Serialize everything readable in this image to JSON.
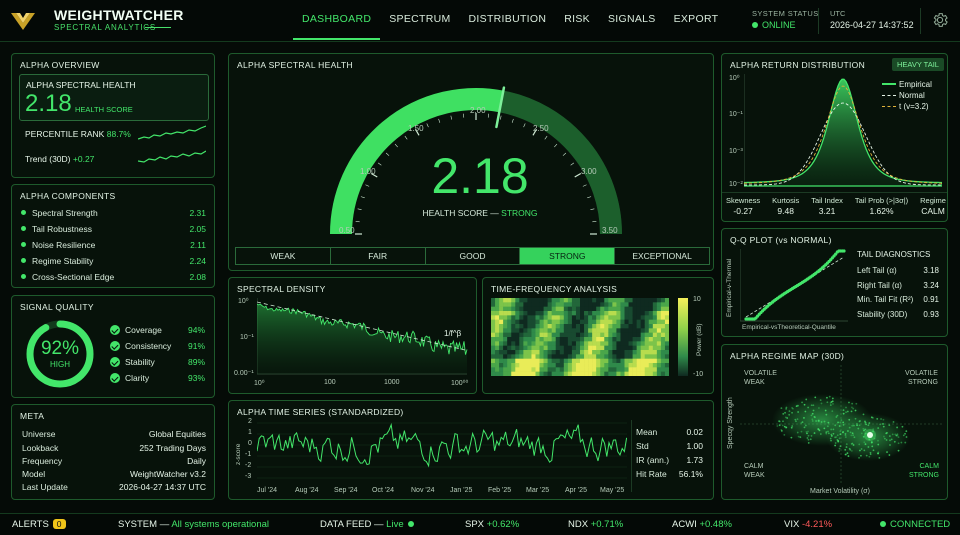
{
  "header": {
    "brand": "WEIGHTWATCHER",
    "subtitle": "SPECTRAL ANALYTICS",
    "nav": [
      "DASHBOARD",
      "SPECTRUM",
      "DISTRIBUTION",
      "RISK",
      "SIGNALS",
      "EXPORT"
    ],
    "active_nav": "DASHBOARD",
    "system_status_label": "SYSTEM STATUS",
    "system_status": "ONLINE",
    "utc_label": "UTC",
    "utc_time": "2026-04-27 14:37:52"
  },
  "alpha_overview": {
    "title": "ALPHA OVERVIEW",
    "health_label": "ALPHA SPECTRAL HEALTH",
    "health_value": "2.18",
    "health_unit": "HEALTH SCORE",
    "percentile_label": "PERCENTILE RANK",
    "percentile_value": "88.7%",
    "trend_label": "Trend (30D)",
    "trend_value": "+0.27"
  },
  "components": {
    "title": "ALPHA COMPONENTS",
    "items": [
      {
        "label": "Spectral Strength",
        "value": "2.31"
      },
      {
        "label": "Tail Robustness",
        "value": "2.05"
      },
      {
        "label": "Noise Resilience",
        "value": "2.11"
      },
      {
        "label": "Regime Stability",
        "value": "2.24"
      },
      {
        "label": "Cross-Sectional Edge",
        "value": "2.08"
      }
    ]
  },
  "signal_quality": {
    "title": "SIGNAL QUALITY",
    "score": "92%",
    "score_fraction": 0.92,
    "score_label": "HIGH",
    "items": [
      {
        "label": "Coverage",
        "value": "94%"
      },
      {
        "label": "Consistency",
        "value": "91%"
      },
      {
        "label": "Stability",
        "value": "89%"
      },
      {
        "label": "Clarity",
        "value": "93%"
      }
    ]
  },
  "meta": {
    "title": "META",
    "items": [
      {
        "label": "Universe",
        "value": "Global Equities"
      },
      {
        "label": "Lookback",
        "value": "252 Trading Days"
      },
      {
        "label": "Frequency",
        "value": "Daily"
      },
      {
        "label": "Model",
        "value": "WeightWatcher v3.2"
      },
      {
        "label": "Last Update",
        "value": "2026-04-27 14:37 UTC"
      }
    ]
  },
  "gauge": {
    "title": "ALPHA SPECTRAL HEALTH",
    "value": "2.18",
    "value_num": 2.18,
    "min": 0.5,
    "max": 3.5,
    "ticks": [
      "0.50",
      "1.00",
      "1.50",
      "2.00",
      "2.50",
      "3.00",
      "3.50"
    ],
    "caption_label": "HEALTH SCORE —",
    "caption_status": "STRONG",
    "bands": [
      "WEAK",
      "FAIR",
      "GOOD",
      "STRONG",
      "EXCEPTIONAL"
    ],
    "active_band": "STRONG"
  },
  "spectral_density": {
    "title": "SPECTRAL DENSITY",
    "y_ticks": [
      "10⁰",
      "10⁻¹",
      "0.00⁻¹"
    ],
    "x_ticks": [
      "10⁰",
      "100",
      "1000",
      "100⁰⁰"
    ],
    "fit_label": "1/f^β"
  },
  "time_frequency": {
    "title": "TIME-FREQUENCY ANALYSIS",
    "colorbar_label": "Power (dB)",
    "colorbar_max": "10",
    "colorbar_min": "-10"
  },
  "distribution": {
    "title": "ALPHA RETURN DISTRIBUTION",
    "badge": "HEAVY TAIL",
    "y_ticks": [
      "10⁰",
      "10⁻¹",
      "10⁻³",
      "10⁻²"
    ],
    "legend": [
      "Empirical",
      "Normal",
      "t (v=3.2)"
    ],
    "stats": [
      {
        "label": "Skewness",
        "value": "-0.27"
      },
      {
        "label": "Kurtosis",
        "value": "9.48"
      },
      {
        "label": "Tail Index",
        "value": "3.21"
      },
      {
        "label": "Tail Prob (>|3σ|)",
        "value": "1.62%"
      },
      {
        "label": "Regime",
        "value": "CALM"
      }
    ]
  },
  "qq": {
    "title": "Q-Q PLOT (vs NORMAL)",
    "y_label": "Empirical-v-Thermal",
    "x_label": "Empirical-vsTheoretical-Quantile",
    "diag_title": "TAIL DIAGNOSTICS",
    "diag": [
      {
        "label": "Left Tail (α)",
        "value": "3.18"
      },
      {
        "label": "Right Tail (α)",
        "value": "3.24"
      },
      {
        "label": "Min. Tail Fit (R²)",
        "value": "0.91"
      },
      {
        "label": "Stability (30D)",
        "value": "0.93"
      }
    ]
  },
  "timeseries": {
    "title": "ALPHA TIME SERIES (STANDARDIZED)",
    "y_label": "z-score",
    "y_ticks": [
      "2",
      "1",
      "0",
      "-1",
      "-2",
      "-3"
    ],
    "x_ticks": [
      "Jul '24",
      "Aug '24",
      "Sep '24",
      "Oct '24",
      "Nov '24",
      "Jan '25",
      "Feb '25",
      "Mar '25",
      "Apr '25",
      "May '25"
    ],
    "stats": [
      {
        "label": "Mean",
        "value": "0.02"
      },
      {
        "label": "Std",
        "value": "1.00"
      },
      {
        "label": "IR (ann.)",
        "value": "1.73"
      },
      {
        "label": "Hit Rate",
        "value": "56.1%"
      }
    ]
  },
  "regime": {
    "title": "ALPHA REGIME MAP (30D)",
    "q_tl": [
      "VOLATILE",
      "WEAK"
    ],
    "q_tr": [
      "VOLATILE",
      "STRONG"
    ],
    "q_bl": [
      "CALM",
      "WEAK"
    ],
    "q_br": [
      "CALM",
      "STRONG"
    ],
    "x_label": "Market Volatility (σ)",
    "y_label": "Specqy Strength"
  },
  "footer": {
    "alerts_label": "ALERTS",
    "alerts_count": "0",
    "system_label": "SYSTEM —",
    "system_value": "All systems operational",
    "feed_label": "DATA FEED —",
    "feed_value": "Live",
    "tickers": [
      {
        "name": "SPX",
        "change": "+0.62%"
      },
      {
        "name": "NDX",
        "change": "+0.71%"
      },
      {
        "name": "ACWI",
        "change": "+0.48%"
      },
      {
        "name": "VIX",
        "change": "-4.21%"
      }
    ],
    "connection": "CONNECTED"
  },
  "colors": {
    "accent": "#43e66a",
    "panel_border": "#1e5a2c",
    "background": "#050b07",
    "warning": "#f0c419",
    "negative": "#ff5a5a"
  }
}
